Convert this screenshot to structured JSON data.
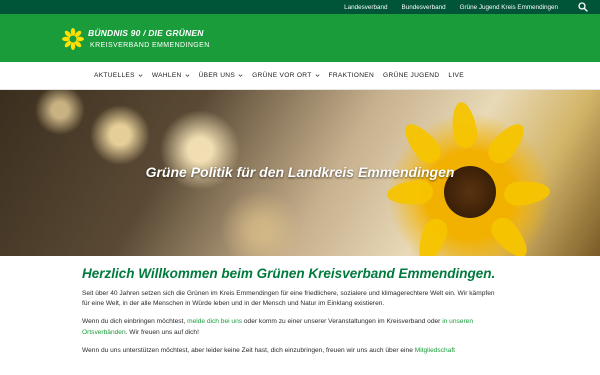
{
  "topbar": {
    "links": [
      "Landesverband",
      "Bundesverband",
      "Grüne Jugend Kreis Emmendingen"
    ],
    "search_icon": "search-icon"
  },
  "brand": {
    "title": "BÜNDNIS 90 / DIE GRÜNEN",
    "subtitle": "KREISVERBAND EMMENDINGEN",
    "logo_icon": "sunflower-logo-icon"
  },
  "nav": {
    "items": [
      "AKTUELLES",
      "WAHLEN",
      "ÜBER UNS",
      "GRÜNE VOR ORT",
      "FRAKTIONEN",
      "GRÜNE JUGEND",
      "LIVE"
    ]
  },
  "hero": {
    "title": "Grüne Politik für den Landkreis Emmendingen"
  },
  "main": {
    "heading": "Herzlich Willkommen beim Grünen Kreisverband Emmendingen.",
    "p1": "Seit über 40 Jahren setzen sich die Grünen im Kreis Emmendingen für eine friedlichere, sozialere und klimagerechtere Welt ein. Wir kämpfen für eine Welt, in der alle Menschen in Würde leben und in der Mensch und Natur im Einklang existieren.",
    "p2_a": "Wenn du dich einbringen möchtest, ",
    "p2_link1": "melde dich bei uns",
    "p2_b": " oder komm zu einer unserer Veranstaltungen im Kreisverband oder ",
    "p2_link2": "in unseren Ortsverbänden",
    "p2_c": ". Wir freuen uns auf dich!",
    "p3_a": "Wenn du uns unterstützen möchtest, aber leider keine Zeit hast, dich einzubringen, freuen wir uns auch über eine ",
    "p3_link": "Mitgliedschaft"
  },
  "colors": {
    "topbar": "#005538",
    "brandbar": "#1a9c3b",
    "heading": "#007a3d",
    "link": "#1a9c3b"
  }
}
